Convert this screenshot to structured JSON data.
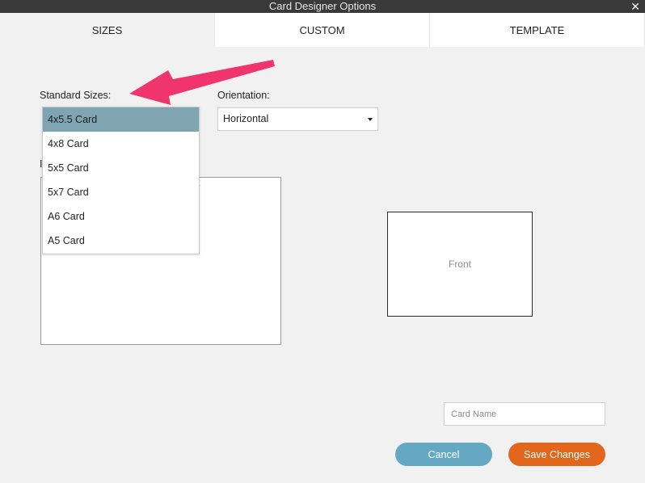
{
  "window": {
    "title": "Card Designer Options",
    "close_glyph": "✕"
  },
  "tabs": [
    {
      "label": "SIZES",
      "active": true
    },
    {
      "label": "CUSTOM",
      "active": false
    },
    {
      "label": "TEMPLATE",
      "active": false
    }
  ],
  "sizes": {
    "standard_label": "Standard Sizes:",
    "options": [
      "4x5.5 Card",
      "4x8 Card",
      "5x5 Card",
      "5x7 Card",
      "A6 Card",
      "A5 Card"
    ],
    "selected": "4x5.5 Card"
  },
  "orientation": {
    "label": "Orientation:",
    "value": "Horizontal"
  },
  "obscured": {
    "label_fragment": "I",
    "peek_fragment": "t"
  },
  "preview": {
    "front_label": "Front"
  },
  "card_name": {
    "placeholder": "Card Name",
    "value": ""
  },
  "actions": {
    "cancel_label": "Cancel",
    "save_label": "Save Changes"
  },
  "colors": {
    "titlebar": "#3a3a3a",
    "selected_item": "#7fa4b2",
    "cancel_button": "#65a8c4",
    "save_button": "#e2661c",
    "annotation_arrow": "#f0356e"
  },
  "icons": {
    "close": "close-icon",
    "dropdown": "chevron-down-icon",
    "annotation": "annotation-arrow"
  }
}
